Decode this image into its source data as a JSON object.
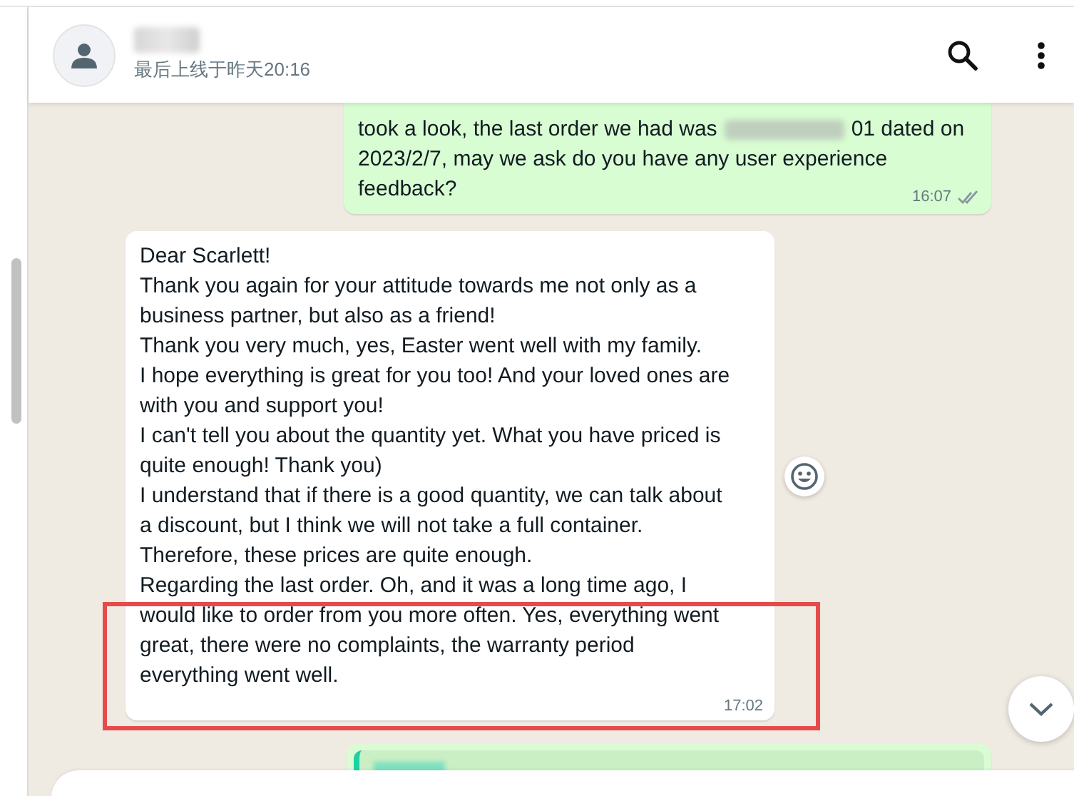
{
  "header": {
    "contact_status": "最后上线于昨天20:16"
  },
  "messages": [
    {
      "kind": "outgoing",
      "text_before_redaction": "took a look, the last order we had was",
      "text_after_redaction": "01 dated on",
      "text_continued": "2023/2/7, may we ask do you have any user experience feedback?",
      "time": "16:07",
      "read": false
    },
    {
      "kind": "incoming",
      "text": "Dear Scarlett!\nThank you again for your attitude towards me not only as a business partner, but also as a friend!\nThank you very much, yes, Easter went well with my family.\nI hope everything is great for you too! And your loved ones are with you and support you!\nI can't tell you about the quantity yet. What you have priced is quite enough! Thank you)\nI understand that if there is a good quantity, we can talk about a discount, but I think we will not take a full container.\nTherefore, these prices are quite enough.\nRegarding the last order. Oh, and it was a long time ago, I would like to order from you more often. Yes, everything went great, there were no complaints, the warranty period everything went well.",
      "time": "17:02",
      "highlighted": true
    },
    {
      "kind": "outgoing_quote"
    }
  ]
}
